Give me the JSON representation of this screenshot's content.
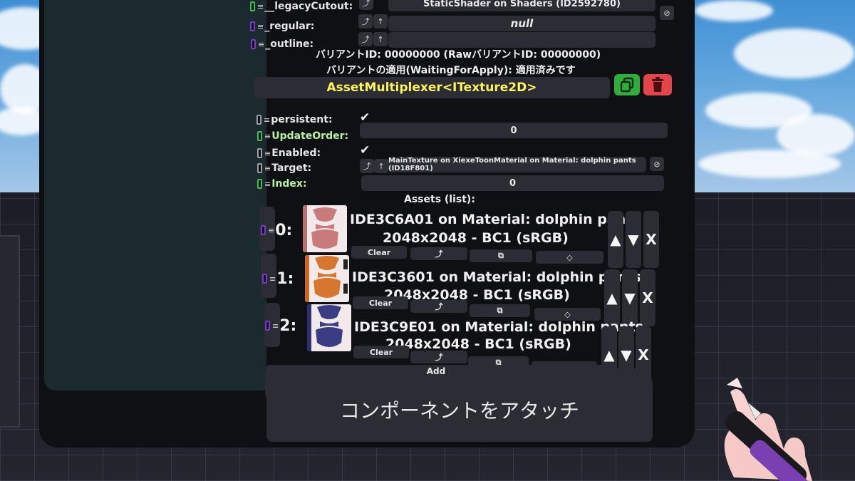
{
  "inspector": {
    "legacy_cutout": {
      "label": "__legacyCutout:",
      "value": "StaticShader on Shaders (ID2592780)"
    },
    "regular": {
      "label": "_regular:",
      "value": "null"
    },
    "outline": {
      "label": "_outline:"
    },
    "variant_id": "バリアントID: 00000000 (RawバリアントID: 00000000)",
    "variant_apply": "バリアントの適用(WaitingForApply): 適用済みです"
  },
  "component": {
    "title": "AssetMultiplexer<ITexture2D>",
    "colors": {
      "title": "#fff35a",
      "duplicate": "#2fae3e",
      "delete": "#e2454a"
    },
    "fields": {
      "persistent": {
        "label": "persistent:",
        "checked": true
      },
      "update_order": {
        "label": "UpdateOrder:",
        "value": "0"
      },
      "enabled": {
        "label": "Enabled:",
        "checked": true
      },
      "target": {
        "label": "Target:",
        "value": "MainTexture on XiexeToonMaterial on Material: dolphin pants (ID18F801)"
      },
      "index": {
        "label": "Index:",
        "value": "0"
      }
    },
    "assets_header": "Assets (list):",
    "assets": [
      {
        "index": "0:",
        "title": "IDE3C6A01 on Material: dolphin pants",
        "sub": "2048x2048 - BC1 (sRGB)",
        "clear": "Clear",
        "color": "#c97a7a"
      },
      {
        "index": "1:",
        "title": "IDE3C3601 on Material: dolphin pants",
        "sub": "2048x2048 - BC1 (sRGB)",
        "clear": "Clear",
        "color": "#d6762f"
      },
      {
        "index": "2:",
        "title": "IDE3C9E01 on Material: dolphin pants",
        "sub": "2048x2048 - BC1 (sRGB)",
        "clear": "Clear",
        "color": "#3a3c84"
      }
    ],
    "add_label": "Add"
  },
  "attach_label": "コンポーネントをアタッチ",
  "icons": {
    "remove": "⊘",
    "up": "↑",
    "jump": "⤴",
    "arrow_up": "▲",
    "arrow_down": "▼",
    "close": "X",
    "duplicate": "duplicate-icon",
    "delete": "trash-icon",
    "copy": "⧉",
    "tag": "◇",
    "check": "✔"
  }
}
